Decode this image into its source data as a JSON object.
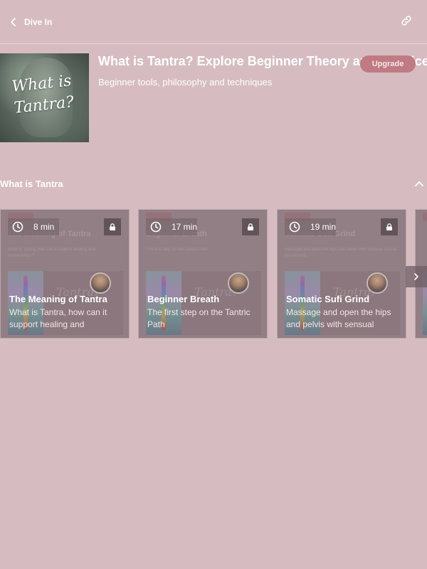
{
  "header": {
    "back_label": "Dive In"
  },
  "course": {
    "thumbnail_text": "What is Tantra?",
    "title": "What is Tantra? Explore Beginner Theory and Practice",
    "subtitle": "Beginner tools, philosophy and techniques",
    "upgrade_label": "Upgrade"
  },
  "section": {
    "title": "What is Tantra"
  },
  "cards": [
    {
      "duration": "8 min",
      "title": "The Meaning of Tantra",
      "description": "What is Tantra, how can it support healing and relationships?",
      "preview_text": "Tantra?"
    },
    {
      "duration": "17 min",
      "title": "Beginner Breath",
      "description": "The first step on the Tantric Path",
      "preview_text": "Tantra?"
    },
    {
      "duration": "19 min",
      "title": "Somatic Sufi Grind",
      "description": "Massage and open the hips and pelvis with sensual circular movements",
      "preview_text": "Tantra?"
    }
  ],
  "colors": {
    "background": "#d6bcc0",
    "upgrade_button": "#c07a83",
    "card": "#a8959a"
  }
}
